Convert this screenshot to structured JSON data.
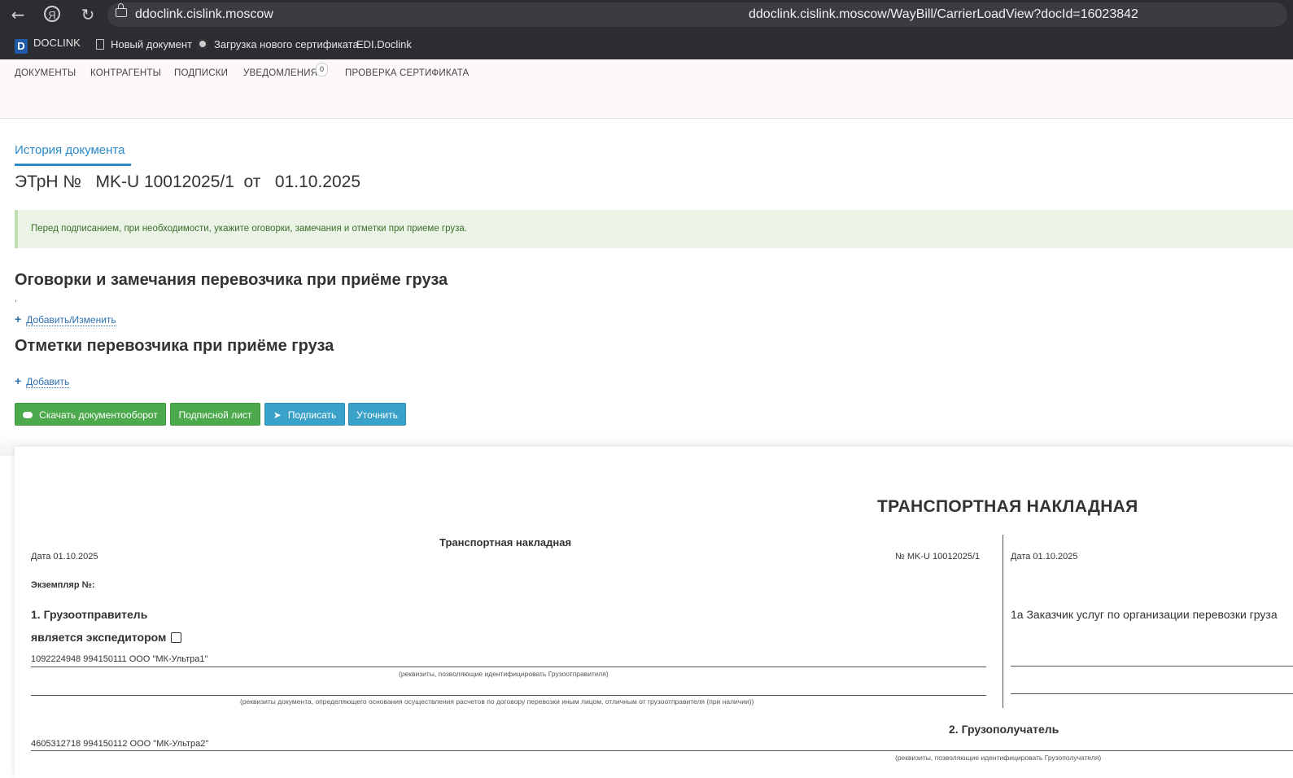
{
  "browser": {
    "host": "ddoclink.cislink.moscow",
    "url": "ddoclink.cislink.moscow/WayBill/CarrierLoadView?docId=16023842",
    "ya_label": "Я"
  },
  "bookmarks": {
    "logo_letter": "D",
    "items": [
      "DOCLINK",
      "Новый документ",
      "Загрузка нового сертификата",
      "EDI.Doclink"
    ]
  },
  "nav": {
    "items": [
      "ДОКУМЕНТЫ",
      "КОНТРАГЕНТЫ",
      "ПОДПИСКИ",
      "УВЕДОМЛЕНИЯ",
      "ПРОВЕРКА СЕРТИФИКАТА"
    ],
    "notifications_count": "0"
  },
  "page": {
    "history_tab": "История документа",
    "doc_title": "ЭТрН №   MK-U 10012025/1  от   01.10.2025",
    "alert": "Перед подписанием, при необходимости, укажите оговорки, замечания и отметки при приеме груза.",
    "section1_title": "Оговорки и замечания перевозчика при приёме груза",
    "section1_value": ",",
    "section1_link": "Добавить/Изменить",
    "section2_title": "Отметки перевозчика при приёме груза",
    "section2_link": "Добавить"
  },
  "buttons": {
    "download": "Скачать документооборот",
    "sign_sheet": "Подписной лист",
    "sign": "Подписать",
    "clarify": "Уточнить"
  },
  "document": {
    "main_title": "ТРАНСПОРТНАЯ НАКЛАДНАЯ",
    "sub_title": "Транспортная накладная",
    "date_left": "Дата  01.10.2025",
    "number": "№    MK-U 10012025/1",
    "date_right": "Дата 01.10.2025",
    "copy_no": "Экземпляр №:",
    "shipper_heading": "1. Грузоотправитель",
    "is_forwarder": "является экспедитором",
    "shipper_value": "1092224948 994150111 ООО \"МК-Ультра1\"",
    "shipper_caption": "(реквизиты, позволяющие идентифицировать Грузоотправителя)",
    "doc_caption": "(реквизиты документа, определяющего основания осуществления расчетов по договору перевозки иным лицом, отличным от грузоотправителя (при наличии))",
    "customer_heading": "1а Заказчик услуг по организации перевозки груза",
    "consignee_heading": "2. Грузополучатель",
    "consignee_value": "4605312718 994150112 ООО \"МК-Ультра2\"",
    "consignee_caption": "(реквизиты, позволяющие идентифицировать Грузополучателя)"
  }
}
